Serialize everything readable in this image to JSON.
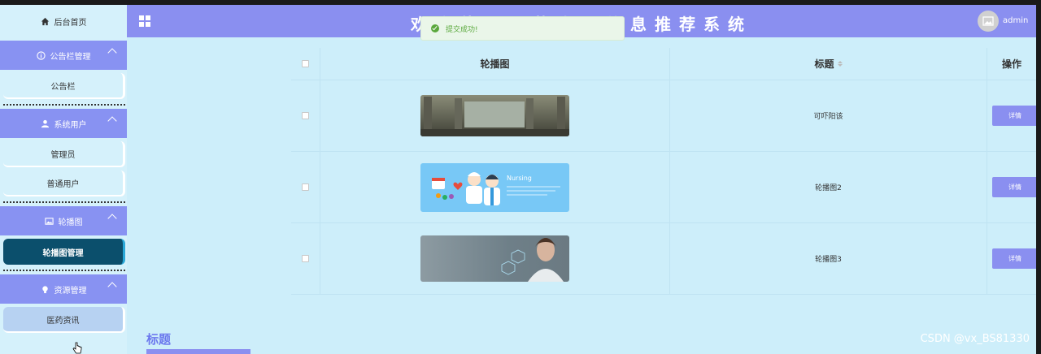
{
  "sidebar": {
    "home": "后台首页",
    "groups": [
      {
        "label": "公告栏管理",
        "icon": "info-circle-icon",
        "items": [
          "公告栏"
        ]
      },
      {
        "label": "系统用户",
        "icon": "user-icon",
        "items": [
          "管理员",
          "普通用户"
        ]
      },
      {
        "label": "轮播图",
        "icon": "image-icon",
        "items": [
          "轮播图管理"
        ]
      },
      {
        "label": "资源管理",
        "icon": "bulb-icon",
        "items": [
          "医药资讯"
        ]
      }
    ]
  },
  "header": {
    "title": "欢迎使用医药资讯信息推荐系统",
    "username": "admin"
  },
  "toast": {
    "message": "提交成功!"
  },
  "table": {
    "headers": {
      "image": "轮播图",
      "title": "标题",
      "action": "操作"
    },
    "rows": [
      {
        "title": "可吓阳该",
        "image": "corridor-photo",
        "action": "详情"
      },
      {
        "title": "轮播图2",
        "image": "nursing-illustration",
        "image_text": "Nursing",
        "action": "详情"
      },
      {
        "title": "轮播图3",
        "image": "doctor-photo",
        "action": "详情"
      }
    ]
  },
  "form": {
    "title_label": "标题"
  },
  "watermark": "CSDN @vx_BS81330",
  "colors": {
    "accent": "#8a8ff0",
    "background": "#cdeefa",
    "active_item": "#0b4f6c",
    "success": "#5aa83c"
  }
}
